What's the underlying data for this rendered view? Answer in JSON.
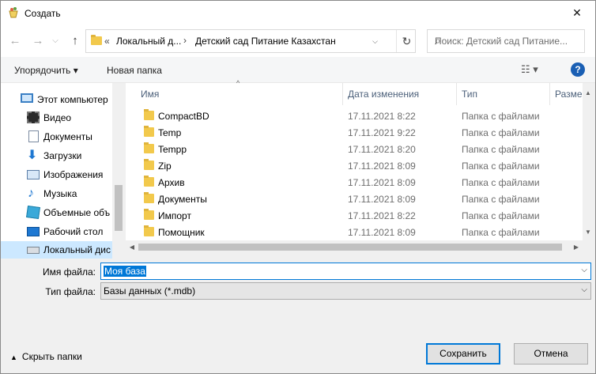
{
  "window": {
    "title": "Создать"
  },
  "nav": {
    "back": "←",
    "forward": "→",
    "up": "↑"
  },
  "address": {
    "overflow": "«",
    "crumbs": [
      "Локальный д...",
      "Детский сад Питание Казахстан"
    ],
    "separator": "›",
    "dropdown": "⌵",
    "refresh": "↻"
  },
  "search": {
    "placeholder": "Поиск: Детский сад Питание..."
  },
  "toolbar": {
    "organize": "Упорядочить ▾",
    "new_folder": "Новая папка",
    "view": "☷ ▾",
    "help": "?"
  },
  "sidebar": {
    "items": [
      {
        "label": "Этот компьютер",
        "icon": "computer-icon"
      },
      {
        "label": "Видео",
        "icon": "video-icon"
      },
      {
        "label": "Документы",
        "icon": "documents-icon"
      },
      {
        "label": "Загрузки",
        "icon": "downloads-icon"
      },
      {
        "label": "Изображения",
        "icon": "pictures-icon"
      },
      {
        "label": "Музыка",
        "icon": "music-icon"
      },
      {
        "label": "Объемные объ",
        "icon": "3d-objects-icon"
      },
      {
        "label": "Рабочий стол",
        "icon": "desktop-icon"
      },
      {
        "label": "Локальный дис",
        "icon": "local-disk-icon"
      }
    ]
  },
  "columns": [
    "Имя",
    "Дата изменения",
    "Тип",
    "Разме"
  ],
  "files": [
    {
      "name": "CompactBD",
      "date": "17.11.2021 8:22",
      "type": "Папка с файлами"
    },
    {
      "name": "Temp",
      "date": "17.11.2021 9:22",
      "type": "Папка с файлами"
    },
    {
      "name": "Tempp",
      "date": "17.11.2021 8:20",
      "type": "Папка с файлами"
    },
    {
      "name": "Zip",
      "date": "17.11.2021 8:09",
      "type": "Папка с файлами"
    },
    {
      "name": "Архив",
      "date": "17.11.2021 8:09",
      "type": "Папка с файлами"
    },
    {
      "name": "Документы",
      "date": "17.11.2021 8:09",
      "type": "Папка с файлами"
    },
    {
      "name": "Импорт",
      "date": "17.11.2021 8:22",
      "type": "Папка с файлами"
    },
    {
      "name": "Помощник",
      "date": "17.11.2021 8:09",
      "type": "Папка с файлами"
    }
  ],
  "form": {
    "filename_label": "Имя файла:",
    "filename_value": "Моя база",
    "filetype_label": "Тип файла:",
    "filetype_value": "Базы данных (*.mdb)"
  },
  "footer": {
    "hide_folders": "Скрыть папки",
    "save": "Сохранить",
    "cancel": "Отмена"
  },
  "colors": {
    "accent": "#0078d7",
    "folder": "#f2c94c",
    "help": "#1a5fb4"
  }
}
